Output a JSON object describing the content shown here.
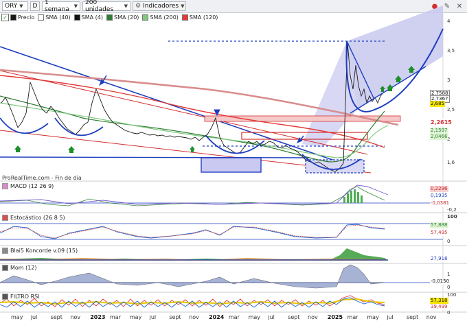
{
  "toolbar": {
    "symbol": "ORY",
    "period_btn": "D",
    "interval": "1 semana",
    "units": "200 unidades",
    "indicators": "Indicadores"
  },
  "legend": [
    {
      "label": "Precio",
      "color": "#1a1a1a",
      "checked": true
    },
    {
      "label": "SMA (40)",
      "color": "#ffffff"
    },
    {
      "label": "SMA (4)",
      "color": "#111111"
    },
    {
      "label": "SMA (20)",
      "color": "#2e7d32"
    },
    {
      "label": "SMA (200)",
      "color": "#7ec97e"
    },
    {
      "label": "SMA (120)",
      "color": "#e53935"
    }
  ],
  "source": "ProRealTime.com - Fin de día",
  "price_axis": [
    "4",
    "3,5",
    "3",
    "2,5",
    "2",
    "1,6"
  ],
  "price_badges": [
    {
      "text": "2,7588",
      "bg": "#ffffff",
      "fg": "#111"
    },
    {
      "text": "2,7367",
      "bg": "#ffffff",
      "fg": "#111"
    },
    {
      "text": "2,685",
      "bg": "#f7e600",
      "fg": "#111"
    },
    {
      "text": "2,2615",
      "bg": "#ffffff",
      "fg": "#d32f2f"
    },
    {
      "text": "2,1597",
      "bg": "#dff5d6",
      "fg": "#2e7d32"
    },
    {
      "text": "2,0466",
      "bg": "#dff5d6",
      "fg": "#2e7d32"
    }
  ],
  "panels": [
    {
      "label": "MACD (12 26 9)",
      "ticks": [
        "0,2296",
        "0,1935",
        "-0,0381",
        "-0,2"
      ]
    },
    {
      "label": "Estocástico (26 8 5)",
      "ticks": [
        "100",
        "57,888",
        "57,495",
        "0"
      ]
    },
    {
      "label": "Blai5 Koncorde v.09 (15)",
      "ticks": [
        "27,918"
      ]
    },
    {
      "label": "Mom (12)",
      "ticks": [
        "1",
        "0",
        "-0,0150"
      ]
    },
    {
      "label": "FILTRO RSI",
      "ticks": [
        "100",
        "57,318",
        "39,499",
        "0"
      ]
    }
  ],
  "x_axis": [
    {
      "label": "may",
      "bold": false
    },
    {
      "label": "jul",
      "bold": false
    },
    {
      "label": "sept",
      "bold": false
    },
    {
      "label": "nov",
      "bold": false
    },
    {
      "label": "2023",
      "bold": true
    },
    {
      "label": "mar",
      "bold": false
    },
    {
      "label": "may",
      "bold": false
    },
    {
      "label": "jul",
      "bold": false
    },
    {
      "label": "sept",
      "bold": false
    },
    {
      "label": "nov",
      "bold": false
    },
    {
      "label": "2024",
      "bold": true
    },
    {
      "label": "mar",
      "bold": false
    },
    {
      "label": "may",
      "bold": false
    },
    {
      "label": "jul",
      "bold": false
    },
    {
      "label": "sept",
      "bold": false
    },
    {
      "label": "nov",
      "bold": false
    },
    {
      "label": "2025",
      "bold": true
    },
    {
      "label": "mar",
      "bold": false
    },
    {
      "label": "may",
      "bold": false
    },
    {
      "label": "jul",
      "bold": false
    },
    {
      "label": "sept",
      "bold": false
    },
    {
      "label": "nov",
      "bold": false
    }
  ]
}
